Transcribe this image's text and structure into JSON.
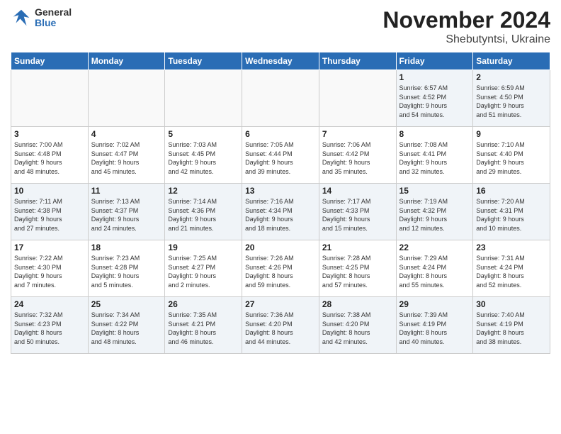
{
  "header": {
    "logo_general": "General",
    "logo_blue": "Blue",
    "title": "November 2024",
    "location": "Shebutyntsi, Ukraine"
  },
  "days_of_week": [
    "Sunday",
    "Monday",
    "Tuesday",
    "Wednesday",
    "Thursday",
    "Friday",
    "Saturday"
  ],
  "weeks": [
    [
      {
        "day": "",
        "info": ""
      },
      {
        "day": "",
        "info": ""
      },
      {
        "day": "",
        "info": ""
      },
      {
        "day": "",
        "info": ""
      },
      {
        "day": "",
        "info": ""
      },
      {
        "day": "1",
        "info": "Sunrise: 6:57 AM\nSunset: 4:52 PM\nDaylight: 9 hours\nand 54 minutes."
      },
      {
        "day": "2",
        "info": "Sunrise: 6:59 AM\nSunset: 4:50 PM\nDaylight: 9 hours\nand 51 minutes."
      }
    ],
    [
      {
        "day": "3",
        "info": "Sunrise: 7:00 AM\nSunset: 4:48 PM\nDaylight: 9 hours\nand 48 minutes."
      },
      {
        "day": "4",
        "info": "Sunrise: 7:02 AM\nSunset: 4:47 PM\nDaylight: 9 hours\nand 45 minutes."
      },
      {
        "day": "5",
        "info": "Sunrise: 7:03 AM\nSunset: 4:45 PM\nDaylight: 9 hours\nand 42 minutes."
      },
      {
        "day": "6",
        "info": "Sunrise: 7:05 AM\nSunset: 4:44 PM\nDaylight: 9 hours\nand 39 minutes."
      },
      {
        "day": "7",
        "info": "Sunrise: 7:06 AM\nSunset: 4:42 PM\nDaylight: 9 hours\nand 35 minutes."
      },
      {
        "day": "8",
        "info": "Sunrise: 7:08 AM\nSunset: 4:41 PM\nDaylight: 9 hours\nand 32 minutes."
      },
      {
        "day": "9",
        "info": "Sunrise: 7:10 AM\nSunset: 4:40 PM\nDaylight: 9 hours\nand 29 minutes."
      }
    ],
    [
      {
        "day": "10",
        "info": "Sunrise: 7:11 AM\nSunset: 4:38 PM\nDaylight: 9 hours\nand 27 minutes."
      },
      {
        "day": "11",
        "info": "Sunrise: 7:13 AM\nSunset: 4:37 PM\nDaylight: 9 hours\nand 24 minutes."
      },
      {
        "day": "12",
        "info": "Sunrise: 7:14 AM\nSunset: 4:36 PM\nDaylight: 9 hours\nand 21 minutes."
      },
      {
        "day": "13",
        "info": "Sunrise: 7:16 AM\nSunset: 4:34 PM\nDaylight: 9 hours\nand 18 minutes."
      },
      {
        "day": "14",
        "info": "Sunrise: 7:17 AM\nSunset: 4:33 PM\nDaylight: 9 hours\nand 15 minutes."
      },
      {
        "day": "15",
        "info": "Sunrise: 7:19 AM\nSunset: 4:32 PM\nDaylight: 9 hours\nand 12 minutes."
      },
      {
        "day": "16",
        "info": "Sunrise: 7:20 AM\nSunset: 4:31 PM\nDaylight: 9 hours\nand 10 minutes."
      }
    ],
    [
      {
        "day": "17",
        "info": "Sunrise: 7:22 AM\nSunset: 4:30 PM\nDaylight: 9 hours\nand 7 minutes."
      },
      {
        "day": "18",
        "info": "Sunrise: 7:23 AM\nSunset: 4:28 PM\nDaylight: 9 hours\nand 5 minutes."
      },
      {
        "day": "19",
        "info": "Sunrise: 7:25 AM\nSunset: 4:27 PM\nDaylight: 9 hours\nand 2 minutes."
      },
      {
        "day": "20",
        "info": "Sunrise: 7:26 AM\nSunset: 4:26 PM\nDaylight: 8 hours\nand 59 minutes."
      },
      {
        "day": "21",
        "info": "Sunrise: 7:28 AM\nSunset: 4:25 PM\nDaylight: 8 hours\nand 57 minutes."
      },
      {
        "day": "22",
        "info": "Sunrise: 7:29 AM\nSunset: 4:24 PM\nDaylight: 8 hours\nand 55 minutes."
      },
      {
        "day": "23",
        "info": "Sunrise: 7:31 AM\nSunset: 4:24 PM\nDaylight: 8 hours\nand 52 minutes."
      }
    ],
    [
      {
        "day": "24",
        "info": "Sunrise: 7:32 AM\nSunset: 4:23 PM\nDaylight: 8 hours\nand 50 minutes."
      },
      {
        "day": "25",
        "info": "Sunrise: 7:34 AM\nSunset: 4:22 PM\nDaylight: 8 hours\nand 48 minutes."
      },
      {
        "day": "26",
        "info": "Sunrise: 7:35 AM\nSunset: 4:21 PM\nDaylight: 8 hours\nand 46 minutes."
      },
      {
        "day": "27",
        "info": "Sunrise: 7:36 AM\nSunset: 4:20 PM\nDaylight: 8 hours\nand 44 minutes."
      },
      {
        "day": "28",
        "info": "Sunrise: 7:38 AM\nSunset: 4:20 PM\nDaylight: 8 hours\nand 42 minutes."
      },
      {
        "day": "29",
        "info": "Sunrise: 7:39 AM\nSunset: 4:19 PM\nDaylight: 8 hours\nand 40 minutes."
      },
      {
        "day": "30",
        "info": "Sunrise: 7:40 AM\nSunset: 4:19 PM\nDaylight: 8 hours\nand 38 minutes."
      }
    ]
  ]
}
